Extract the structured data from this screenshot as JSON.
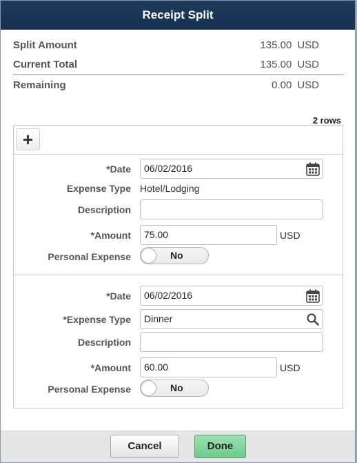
{
  "dialog": {
    "title": "Receipt Split"
  },
  "summary": {
    "split_amount": {
      "label": "Split Amount",
      "value": "135.00",
      "currency": "USD"
    },
    "current_total": {
      "label": "Current Total",
      "value": "135.00",
      "currency": "USD"
    },
    "remaining": {
      "label": "Remaining",
      "value": "0.00",
      "currency": "USD"
    }
  },
  "grid": {
    "row_count": "2 rows",
    "add_label": "+",
    "rows": [
      {
        "date_label": "*Date",
        "date_value": "06/02/2016",
        "expense_type_label": "Expense Type",
        "expense_type_value": "Hotel/Lodging",
        "description_label": "Description",
        "description_value": "",
        "amount_label": "*Amount",
        "amount_value": "75.00",
        "amount_currency": "USD",
        "personal_label": "Personal Expense",
        "personal_value": "No"
      },
      {
        "date_label": "*Date",
        "date_value": "06/02/2016",
        "expense_type_label": "*Expense Type",
        "expense_type_value": "Dinner",
        "description_label": "Description",
        "description_value": "",
        "amount_label": "*Amount",
        "amount_value": "60.00",
        "amount_currency": "USD",
        "personal_label": "Personal Expense",
        "personal_value": "No"
      }
    ]
  },
  "footer": {
    "cancel_label": "Cancel",
    "done_label": "Done"
  },
  "icons": {
    "calendar": "calendar-icon",
    "search": "search-icon",
    "add": "plus-icon"
  },
  "colors": {
    "titlebar": "#1e3b5e",
    "done_button": "#6dcb8c"
  }
}
